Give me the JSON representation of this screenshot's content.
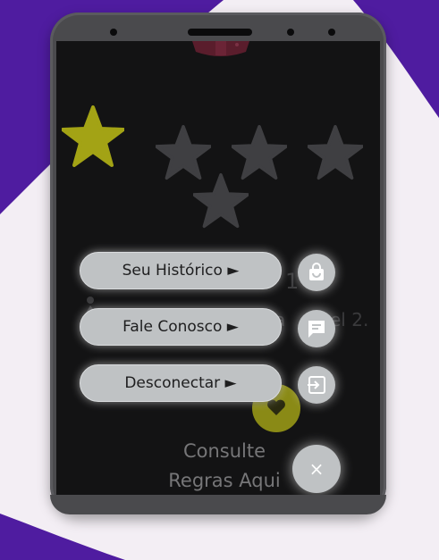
{
  "menu": {
    "history_label": "Seu Histórico ►",
    "contact_label": "Fale Conosco ►",
    "logout_label": "Desconectar ►"
  },
  "background": {
    "level_text": "1",
    "progress_text_a": "a",
    "progress_text_b": "el 2."
  },
  "rules": {
    "line1": "Consulte",
    "line2": "Regras Aqui"
  },
  "close_symbol": "×",
  "stars": {
    "filled": 1,
    "total": 5
  },
  "colors": {
    "background_purple": "#4f1ca0",
    "page_background": "#f3eef4",
    "phone_frame": "#4a4a4d",
    "screen": "#131314",
    "star_filled": "#a3a315",
    "star_empty": "#3f3f42",
    "menu_button": "#bfc2c4"
  },
  "icons": {
    "history": "shopping-bag-icon",
    "contact": "chat-bubble-icon",
    "logout": "exit-icon",
    "close": "close-icon",
    "heart": "heart-icon"
  }
}
